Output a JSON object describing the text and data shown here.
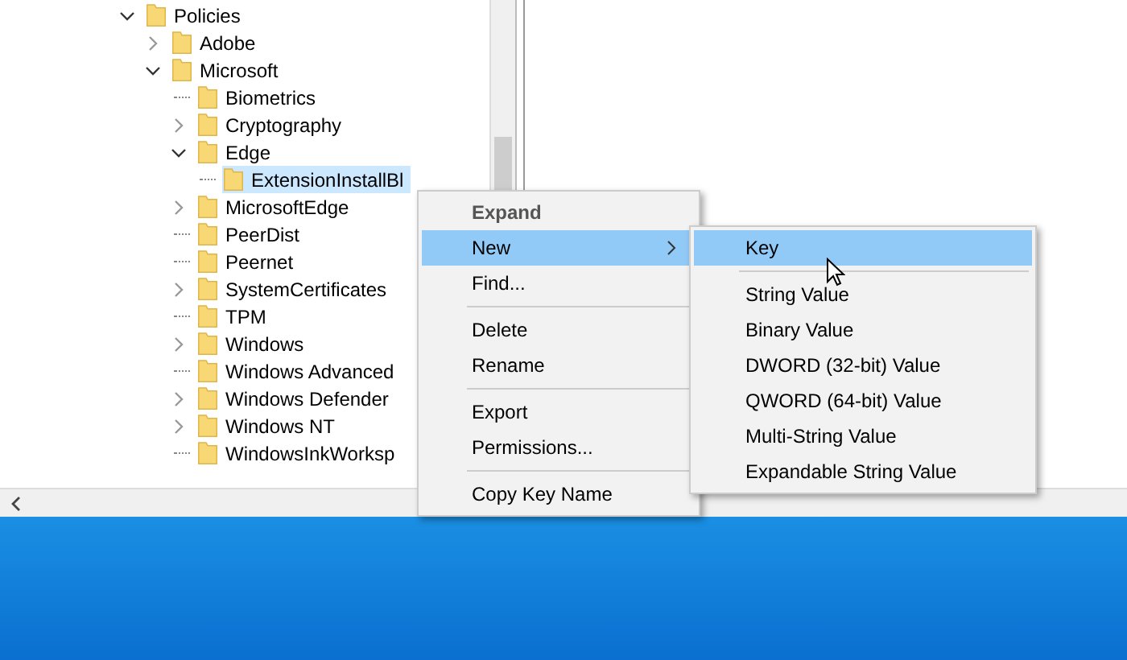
{
  "tree": {
    "nodes": [
      {
        "label": "Policies",
        "has_subkeys": true,
        "expanded": true,
        "selected": false,
        "children": [
          {
            "label": "Adobe",
            "has_subkeys": true,
            "expanded": false,
            "selected": false
          },
          {
            "label": "Microsoft",
            "has_subkeys": true,
            "expanded": true,
            "selected": false,
            "children": [
              {
                "label": "Biometrics",
                "has_subkeys": false,
                "selected": false
              },
              {
                "label": "Cryptography",
                "has_subkeys": true,
                "expanded": false,
                "selected": false
              },
              {
                "label": "Edge",
                "has_subkeys": true,
                "expanded": true,
                "selected": false,
                "children": [
                  {
                    "label": "ExtensionInstallBl",
                    "has_subkeys": false,
                    "selected": true
                  }
                ]
              },
              {
                "label": "MicrosoftEdge",
                "has_subkeys": true,
                "expanded": false,
                "selected": false
              },
              {
                "label": "PeerDist",
                "has_subkeys": false,
                "selected": false
              },
              {
                "label": "Peernet",
                "has_subkeys": false,
                "selected": false
              },
              {
                "label": "SystemCertificates",
                "has_subkeys": true,
                "expanded": false,
                "selected": false
              },
              {
                "label": "TPM",
                "has_subkeys": false,
                "selected": false
              },
              {
                "label": "Windows",
                "has_subkeys": true,
                "expanded": false,
                "selected": false
              },
              {
                "label": "Windows Advanced",
                "has_subkeys": false,
                "selected": false
              },
              {
                "label": "Windows Defender",
                "has_subkeys": true,
                "expanded": false,
                "selected": false
              },
              {
                "label": "Windows NT",
                "has_subkeys": true,
                "expanded": false,
                "selected": false
              },
              {
                "label": "WindowsInkWorksp",
                "has_subkeys": false,
                "selected": false
              }
            ]
          }
        ]
      }
    ]
  },
  "context_menu": {
    "items": [
      {
        "kind": "item",
        "label": "Expand",
        "default": true,
        "highlighted": false,
        "submenu": false
      },
      {
        "kind": "item",
        "label": "New",
        "default": false,
        "highlighted": true,
        "submenu": true
      },
      {
        "kind": "item",
        "label": "Find...",
        "default": false,
        "highlighted": false,
        "submenu": false
      },
      {
        "kind": "separator"
      },
      {
        "kind": "item",
        "label": "Delete",
        "default": false,
        "highlighted": false,
        "submenu": false
      },
      {
        "kind": "item",
        "label": "Rename",
        "default": false,
        "highlighted": false,
        "submenu": false
      },
      {
        "kind": "separator"
      },
      {
        "kind": "item",
        "label": "Export",
        "default": false,
        "highlighted": false,
        "submenu": false
      },
      {
        "kind": "item",
        "label": "Permissions...",
        "default": false,
        "highlighted": false,
        "submenu": false
      },
      {
        "kind": "separator"
      },
      {
        "kind": "item",
        "label": "Copy Key Name",
        "default": false,
        "highlighted": false,
        "submenu": false
      }
    ]
  },
  "submenu": {
    "items": [
      {
        "kind": "item",
        "label": "Key",
        "highlighted": true
      },
      {
        "kind": "separator"
      },
      {
        "kind": "item",
        "label": "String Value",
        "highlighted": false
      },
      {
        "kind": "item",
        "label": "Binary Value",
        "highlighted": false
      },
      {
        "kind": "item",
        "label": "DWORD (32-bit) Value",
        "highlighted": false
      },
      {
        "kind": "item",
        "label": "QWORD (64-bit) Value",
        "highlighted": false
      },
      {
        "kind": "item",
        "label": "Multi-String Value",
        "highlighted": false
      },
      {
        "kind": "item",
        "label": "Expandable String Value",
        "highlighted": false
      }
    ]
  }
}
